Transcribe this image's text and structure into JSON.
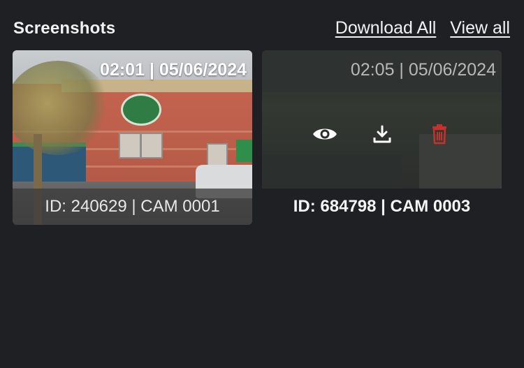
{
  "header": {
    "title": "Screenshots",
    "download_all_label": "Download All",
    "view_all_label": "View all"
  },
  "cards": [
    {
      "timestamp": "02:01 | 05/06/2024",
      "caption": "ID: 240629 | CAM 0001"
    },
    {
      "timestamp": "02:05 | 05/06/2024",
      "caption": "ID: 684798 | CAM 0003",
      "actions": {
        "view_icon": "eye-icon",
        "download_icon": "download-icon",
        "delete_icon": "trash-icon"
      }
    }
  ],
  "colors": {
    "background": "#1f2023",
    "delete_accent": "#c6312b",
    "text": "#f2f2f2"
  }
}
